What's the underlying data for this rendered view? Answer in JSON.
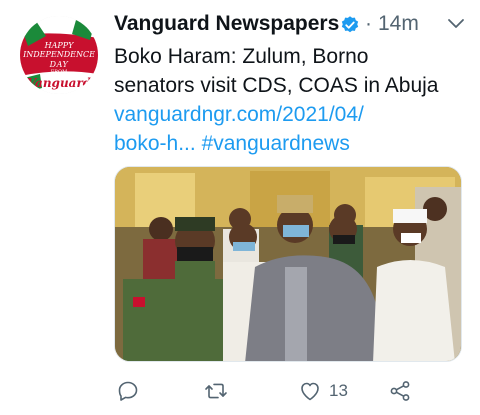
{
  "avatar": {
    "line1": "HAPPY",
    "line2": "INDEPENDENCE",
    "line3": "DAY",
    "line4": "FROM",
    "brand": "Vanguard",
    "icon": "vanguard-independence-day-avatar"
  },
  "header": {
    "display_name": "Vanguard Newspapers",
    "verified_icon": "verified-badge-icon",
    "separator": "·",
    "timestamp": "14m",
    "menu_icon": "chevron-down-icon"
  },
  "tweet": {
    "text_line1": "Boko Haram: Zulum, Borno",
    "text_line2": "senators visit CDS, COAS in Abuja",
    "link_line1": "vanguardngr.com/2021/04/",
    "link_line2": "boko-h...",
    "hashtag": "#vanguardnews"
  },
  "media": {
    "kind": "photo"
  },
  "actions": {
    "reply_icon": "reply-icon",
    "retweet_icon": "retweet-icon",
    "like_icon": "heart-icon",
    "like_count": "13",
    "share_icon": "share-icon"
  },
  "colors": {
    "accent": "#1d9bf0",
    "secondary_text": "#536471",
    "primary_text": "#0f1419"
  }
}
